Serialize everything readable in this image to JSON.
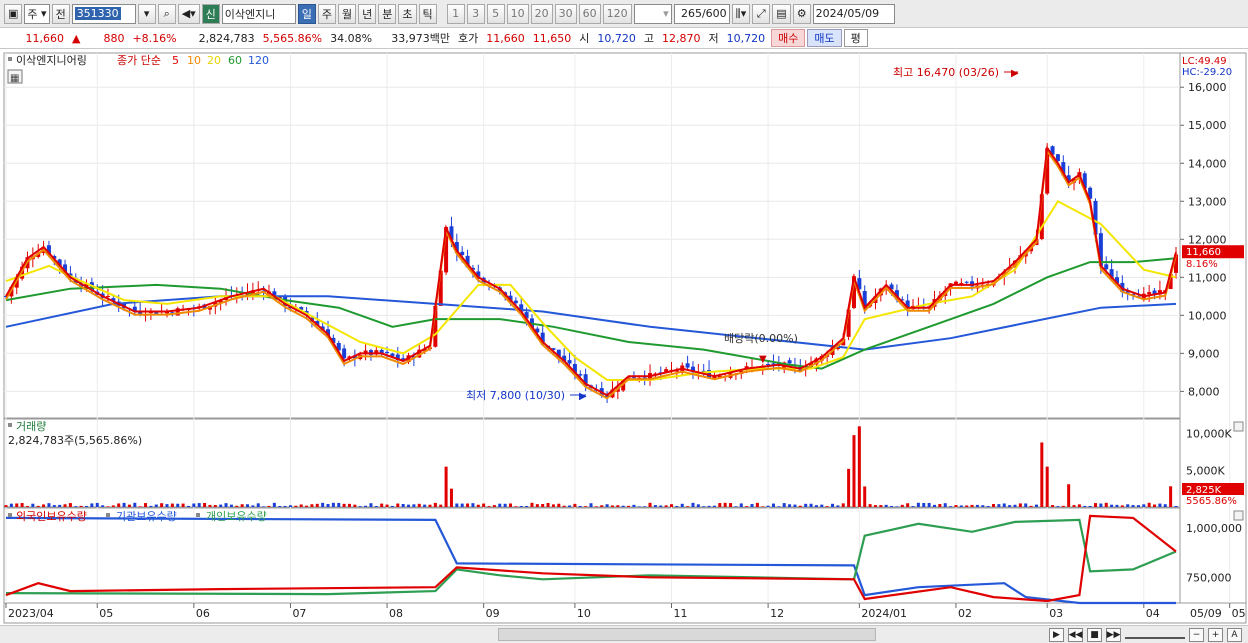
{
  "toolbar": {
    "market_type": "주",
    "prefix": "전",
    "code": "351330",
    "badge": "신",
    "stock_name": "이삭엔지니",
    "periods": [
      "일",
      "주",
      "월",
      "년",
      "분",
      "초",
      "틱"
    ],
    "active_period": "일",
    "intervals": [
      "1",
      "3",
      "5",
      "10",
      "20",
      "30",
      "60",
      "120"
    ],
    "count": "265",
    "count_total": "/600",
    "date": "2024/05/09"
  },
  "quote": {
    "price": "11,660",
    "change": "880",
    "change_pct": "+8.16%",
    "volume": "2,824,783",
    "volume_ratio": "5,565.86%",
    "turnover": "34.08%",
    "amount": "33,973백만",
    "ask_label": "호가",
    "ask": "11,660",
    "bid": "11,650",
    "open_label": "시",
    "open": "10,720",
    "high_label": "고",
    "high": "12,870",
    "low_label": "저",
    "low": "10,720",
    "buy_label": "매수",
    "sell_label": "매도",
    "eval_label": "평"
  },
  "legend": {
    "name": "이삭엔지니어링",
    "ma_label": "종가 단순",
    "ma_periods": [
      "5",
      "10",
      "20",
      "60",
      "120"
    ]
  },
  "annotations": {
    "high": "최고 16,470 (03/26)",
    "low": "최저 7,800 (10/30)",
    "dividend": "배당락(0.00%)",
    "lc": "LC:49.49",
    "hc": "HC:-29.20",
    "price_tag": "11,660",
    "pct_tag": "8.16%"
  },
  "volume_panel": {
    "title": "거래량",
    "info": "2,824,783주(5,565.86%)",
    "tag_value": "2,825K",
    "tag_pct": "5565.86%"
  },
  "holdings_panel": {
    "series_labels": [
      "외국인보유수량",
      "기관보유수량",
      "개인보유수량"
    ]
  },
  "colors": {
    "candle_up": "#e00000",
    "candle_down": "#1a3fd8",
    "ma5": "#e00000",
    "ma10": "#f08a00",
    "ma20": "#f5e600",
    "ma60": "#1f9a2f",
    "ma120": "#2458d8",
    "foreign": "#e00000",
    "institution": "#2458d8",
    "individual": "#2e9e52"
  },
  "chart_data": [
    {
      "type": "candlestick",
      "title": "이삭엔지니어링",
      "x_months": [
        "2023/04",
        "05",
        "06",
        "07",
        "08",
        "09",
        "10",
        "11",
        "12",
        "2024/01",
        "02",
        "03",
        "04",
        "05",
        "05/09"
      ],
      "y_ticks": [
        "16,000",
        "15,000",
        "14,000",
        "13,000",
        "12,000",
        "11,000",
        "10,000",
        "9,000",
        "8,000"
      ],
      "ylim": [
        7300,
        16900
      ],
      "close_path": [
        [
          0,
          10500
        ],
        [
          4,
          11500
        ],
        [
          7,
          11800
        ],
        [
          12,
          11000
        ],
        [
          18,
          10500
        ],
        [
          24,
          10100
        ],
        [
          30,
          10100
        ],
        [
          36,
          10200
        ],
        [
          42,
          10500
        ],
        [
          48,
          10700
        ],
        [
          52,
          10300
        ],
        [
          56,
          10000
        ],
        [
          60,
          9500
        ],
        [
          63,
          8800
        ],
        [
          66,
          9000
        ],
        [
          70,
          9000
        ],
        [
          74,
          8800
        ],
        [
          79,
          9200
        ],
        [
          82,
          12300
        ],
        [
          84,
          11700
        ],
        [
          88,
          11000
        ],
        [
          92,
          10700
        ],
        [
          96,
          10100
        ],
        [
          100,
          9300
        ],
        [
          104,
          8800
        ],
        [
          108,
          8200
        ],
        [
          112,
          7900
        ],
        [
          116,
          8400
        ],
        [
          120,
          8400
        ],
        [
          126,
          8600
        ],
        [
          132,
          8400
        ],
        [
          138,
          8600
        ],
        [
          144,
          8700
        ],
        [
          148,
          8600
        ],
        [
          152,
          8900
        ],
        [
          156,
          9400
        ],
        [
          158,
          11000
        ],
        [
          160,
          10200
        ],
        [
          164,
          10800
        ],
        [
          168,
          10200
        ],
        [
          172,
          10200
        ],
        [
          176,
          10800
        ],
        [
          180,
          10800
        ],
        [
          184,
          10900
        ],
        [
          188,
          11400
        ],
        [
          192,
          12000
        ],
        [
          194,
          14400
        ],
        [
          196,
          14000
        ],
        [
          198,
          13500
        ],
        [
          200,
          13700
        ],
        [
          202,
          13000
        ],
        [
          204,
          11300
        ],
        [
          208,
          10700
        ],
        [
          212,
          10500
        ],
        [
          216,
          10600
        ],
        [
          218,
          11660
        ]
      ],
      "moving_averages": {
        "ma20": [
          [
            0,
            10900
          ],
          [
            8,
            11300
          ],
          [
            14,
            10900
          ],
          [
            22,
            10400
          ],
          [
            30,
            10300
          ],
          [
            40,
            10500
          ],
          [
            50,
            10500
          ],
          [
            58,
            9900
          ],
          [
            66,
            9300
          ],
          [
            74,
            9000
          ],
          [
            80,
            9500
          ],
          [
            88,
            10800
          ],
          [
            94,
            10800
          ],
          [
            100,
            9800
          ],
          [
            106,
            8900
          ],
          [
            112,
            8300
          ],
          [
            120,
            8300
          ],
          [
            130,
            8500
          ],
          [
            140,
            8600
          ],
          [
            150,
            8600
          ],
          [
            156,
            8900
          ],
          [
            160,
            9900
          ],
          [
            166,
            10100
          ],
          [
            172,
            10300
          ],
          [
            180,
            10500
          ],
          [
            188,
            11200
          ],
          [
            196,
            13000
          ],
          [
            204,
            12400
          ],
          [
            212,
            11200
          ],
          [
            218,
            11000
          ]
        ],
        "ma60": [
          [
            0,
            10400
          ],
          [
            12,
            10700
          ],
          [
            28,
            10800
          ],
          [
            40,
            10700
          ],
          [
            52,
            10400
          ],
          [
            62,
            10200
          ],
          [
            72,
            9700
          ],
          [
            80,
            9900
          ],
          [
            92,
            9900
          ],
          [
            102,
            9700
          ],
          [
            116,
            9300
          ],
          [
            130,
            9100
          ],
          [
            146,
            8700
          ],
          [
            152,
            8600
          ],
          [
            160,
            9100
          ],
          [
            172,
            9700
          ],
          [
            184,
            10300
          ],
          [
            194,
            11000
          ],
          [
            202,
            11400
          ],
          [
            210,
            11400
          ],
          [
            218,
            11500
          ]
        ],
        "ma120": [
          [
            0,
            9700
          ],
          [
            20,
            10300
          ],
          [
            40,
            10500
          ],
          [
            60,
            10500
          ],
          [
            80,
            10300
          ],
          [
            100,
            10100
          ],
          [
            120,
            9700
          ],
          [
            140,
            9400
          ],
          [
            160,
            9100
          ],
          [
            176,
            9400
          ],
          [
            190,
            9800
          ],
          [
            204,
            10200
          ],
          [
            218,
            10300
          ]
        ]
      }
    },
    {
      "type": "bar",
      "title": "거래량",
      "y_ticks": [
        "10,000K",
        "5,000K"
      ],
      "ylim": [
        0,
        12000000
      ],
      "last_value": 2825000
    },
    {
      "type": "line",
      "series": [
        {
          "name": "외국인보유수량"
        },
        {
          "name": "기관보유수량"
        },
        {
          "name": "개인보유수량"
        }
      ],
      "y_ticks": [
        "1,000,000",
        "750,000"
      ]
    }
  ]
}
